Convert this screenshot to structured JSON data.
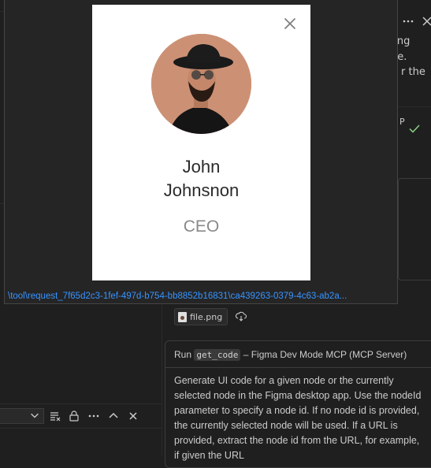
{
  "preview": {
    "name": "John Johnsnon",
    "role": "CEO",
    "path": "\\tool\\request_7f65d2c3-1fef-497d-b754-bb8852b16831\\ca439263-0379-4c63-ab2a..."
  },
  "chat": {
    "partial_lines": [
      "cting",
      "ode.",
      "r the"
    ],
    "partial_label": "P",
    "attachment_name": "file.png",
    "tool_run_label": "Run",
    "tool_name": "get_code",
    "tool_source": "– Figma Dev Mode MCP (MCP Server)",
    "tool_description": "Generate UI code for a given node or the currently selected node in the Figma desktop app. Use the nodeId parameter to specify a node id. If no node id is provided, the currently selected node will be used. If a URL is provided, extract the node id from the URL, for example, if given the URL"
  },
  "colors": {
    "background": "#1f1f1f",
    "link": "#3794ff",
    "check": "#89d185"
  },
  "icons": [
    "close-icon",
    "more-icon",
    "check-icon",
    "chevron-down-icon",
    "clear-output-icon",
    "lock-icon",
    "chevron-up-icon",
    "download-icon",
    "file-icon"
  ]
}
